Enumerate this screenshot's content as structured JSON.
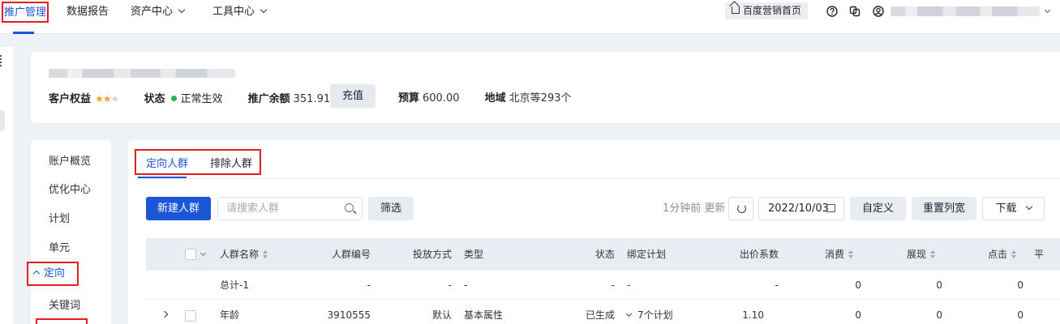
{
  "topnav": {
    "items": [
      {
        "label": "推广管理",
        "active": true
      },
      {
        "label": "数据报告"
      },
      {
        "label": "资产中心",
        "dropdown": true
      },
      {
        "label": "工具中心",
        "dropdown": true
      }
    ],
    "home_link": "百度营销首页",
    "icons": [
      "help-icon",
      "copy-icon",
      "user-icon"
    ]
  },
  "account": {
    "rating_label": "客户权益",
    "rating_stars": 2,
    "rating_max": 3,
    "status_label": "状态",
    "status_value": "正常生效",
    "status_color": "#21b35a",
    "balance_label": "推广余额",
    "balance_value": "351.91",
    "recharge_button": "充值",
    "budget_label": "预算",
    "budget_value": "600.00",
    "region_label": "地域",
    "region_value": "北京等293个"
  },
  "side_menu": {
    "items": [
      "账户概览",
      "优化中心",
      "计划",
      "单元",
      "定向",
      "关键词"
    ],
    "active": "定向"
  },
  "tabs": {
    "items": [
      "定向人群",
      "排除人群"
    ],
    "active": "定向人群"
  },
  "toolbar": {
    "new_button": "新建人群",
    "search_placeholder": "请搜索人群",
    "filter_button": "筛选",
    "update_text": "1分钟前 更新",
    "date_value": "2022/10/03",
    "custom_button": "自定义",
    "reset_columns_button": "重置列宽",
    "download_button": "下载"
  },
  "table": {
    "columns": [
      "人群名称",
      "人群编号",
      "投放方式",
      "类型",
      "状态",
      "绑定计划",
      "出价系数",
      "消费",
      "展现",
      "点击",
      "平"
    ],
    "total_row": {
      "name": "总计-1",
      "id": "-",
      "delivery": "-",
      "type": "-",
      "status": "-",
      "plans": "-",
      "bid": "-",
      "cost": "0",
      "impressions": "0",
      "clicks": "0"
    },
    "rows": [
      {
        "name": "年龄",
        "id": "3910555",
        "delivery": "默认",
        "type": "基本属性",
        "status": "已生成",
        "plans": "7个计划",
        "bid": "1.10",
        "cost": "0",
        "impressions": "0",
        "clicks": "0"
      }
    ]
  },
  "colors": {
    "primary": "#1a56d6",
    "highlight_border": "#e02020",
    "star": "#f5a623"
  }
}
